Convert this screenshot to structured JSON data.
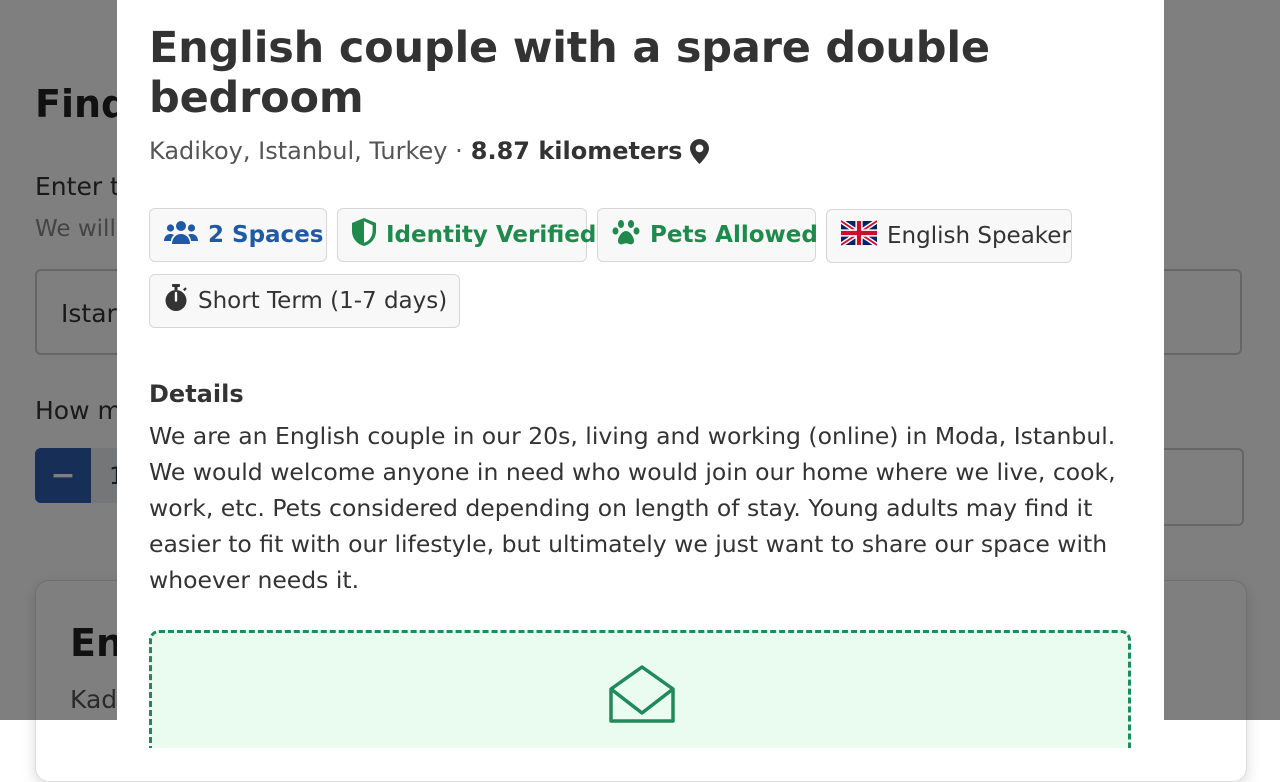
{
  "background": {
    "title": "Find",
    "location_label": "Enter t",
    "location_help": "We will",
    "location_value": "Istar",
    "spaces_label": "How m",
    "minus_label": "−",
    "stepper_value": "1",
    "card_title": "En",
    "card_location": "Kad"
  },
  "listing": {
    "title": "English couple with a spare double bedroom",
    "location": "Kadikoy, Istanbul, Turkey ·",
    "distance": "8.87 kilometers",
    "badges": [
      {
        "label": "2 Spaces",
        "icon": "users-icon",
        "color": "#1f5aa6"
      },
      {
        "label": "Identity Verified",
        "icon": "shield-icon",
        "color": "#1f8a4c"
      },
      {
        "label": "Pets Allowed",
        "icon": "paw-icon",
        "color": "#1f8a4c"
      },
      {
        "label": "English Speaker",
        "icon": "uk-flag-icon",
        "color": "#333333"
      },
      {
        "label": "Short Term (1-7 days)",
        "icon": "stopwatch-icon",
        "color": "#333333"
      }
    ],
    "details_heading": "Details",
    "details_text": "We are an English couple in our 20s, living and working (online) in Moda, Istanbul. We would welcome anyone in need who would join our home where we live, cook, work, etc. Pets considered depending on length of stay. Young adults may find it easier to fit with our lifestyle, but ultimately we just want to share our space with whoever needs it.",
    "contact_icon": "envelope-open-icon"
  },
  "colors": {
    "accent_blue": "#1f5aa6",
    "accent_green": "#1f8a4c",
    "contact_bg": "#eafbef",
    "contact_border": "#1f8a5b",
    "overlay": "rgba(0,0,0,0.5)"
  }
}
